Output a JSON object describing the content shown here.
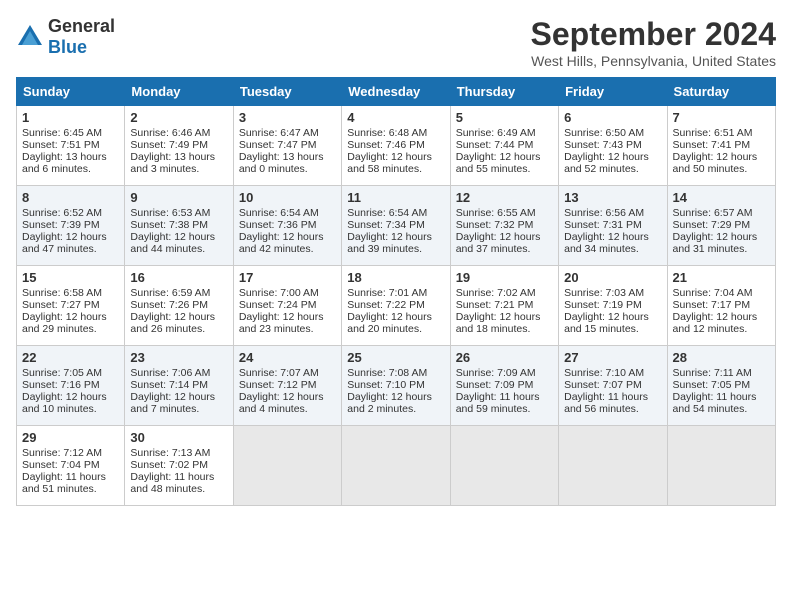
{
  "logo": {
    "general": "General",
    "blue": "Blue"
  },
  "title": "September 2024",
  "location": "West Hills, Pennsylvania, United States",
  "days_of_week": [
    "Sunday",
    "Monday",
    "Tuesday",
    "Wednesday",
    "Thursday",
    "Friday",
    "Saturday"
  ],
  "weeks": [
    [
      {
        "day": "1",
        "sunrise": "6:45 AM",
        "sunset": "7:51 PM",
        "daylight": "13 hours and 6 minutes."
      },
      {
        "day": "2",
        "sunrise": "6:46 AM",
        "sunset": "7:49 PM",
        "daylight": "13 hours and 3 minutes."
      },
      {
        "day": "3",
        "sunrise": "6:47 AM",
        "sunset": "7:47 PM",
        "daylight": "13 hours and 0 minutes."
      },
      {
        "day": "4",
        "sunrise": "6:48 AM",
        "sunset": "7:46 PM",
        "daylight": "12 hours and 58 minutes."
      },
      {
        "day": "5",
        "sunrise": "6:49 AM",
        "sunset": "7:44 PM",
        "daylight": "12 hours and 55 minutes."
      },
      {
        "day": "6",
        "sunrise": "6:50 AM",
        "sunset": "7:43 PM",
        "daylight": "12 hours and 52 minutes."
      },
      {
        "day": "7",
        "sunrise": "6:51 AM",
        "sunset": "7:41 PM",
        "daylight": "12 hours and 50 minutes."
      }
    ],
    [
      {
        "day": "8",
        "sunrise": "6:52 AM",
        "sunset": "7:39 PM",
        "daylight": "12 hours and 47 minutes."
      },
      {
        "day": "9",
        "sunrise": "6:53 AM",
        "sunset": "7:38 PM",
        "daylight": "12 hours and 44 minutes."
      },
      {
        "day": "10",
        "sunrise": "6:54 AM",
        "sunset": "7:36 PM",
        "daylight": "12 hours and 42 minutes."
      },
      {
        "day": "11",
        "sunrise": "6:54 AM",
        "sunset": "7:34 PM",
        "daylight": "12 hours and 39 minutes."
      },
      {
        "day": "12",
        "sunrise": "6:55 AM",
        "sunset": "7:32 PM",
        "daylight": "12 hours and 37 minutes."
      },
      {
        "day": "13",
        "sunrise": "6:56 AM",
        "sunset": "7:31 PM",
        "daylight": "12 hours and 34 minutes."
      },
      {
        "day": "14",
        "sunrise": "6:57 AM",
        "sunset": "7:29 PM",
        "daylight": "12 hours and 31 minutes."
      }
    ],
    [
      {
        "day": "15",
        "sunrise": "6:58 AM",
        "sunset": "7:27 PM",
        "daylight": "12 hours and 29 minutes."
      },
      {
        "day": "16",
        "sunrise": "6:59 AM",
        "sunset": "7:26 PM",
        "daylight": "12 hours and 26 minutes."
      },
      {
        "day": "17",
        "sunrise": "7:00 AM",
        "sunset": "7:24 PM",
        "daylight": "12 hours and 23 minutes."
      },
      {
        "day": "18",
        "sunrise": "7:01 AM",
        "sunset": "7:22 PM",
        "daylight": "12 hours and 20 minutes."
      },
      {
        "day": "19",
        "sunrise": "7:02 AM",
        "sunset": "7:21 PM",
        "daylight": "12 hours and 18 minutes."
      },
      {
        "day": "20",
        "sunrise": "7:03 AM",
        "sunset": "7:19 PM",
        "daylight": "12 hours and 15 minutes."
      },
      {
        "day": "21",
        "sunrise": "7:04 AM",
        "sunset": "7:17 PM",
        "daylight": "12 hours and 12 minutes."
      }
    ],
    [
      {
        "day": "22",
        "sunrise": "7:05 AM",
        "sunset": "7:16 PM",
        "daylight": "12 hours and 10 minutes."
      },
      {
        "day": "23",
        "sunrise": "7:06 AM",
        "sunset": "7:14 PM",
        "daylight": "12 hours and 7 minutes."
      },
      {
        "day": "24",
        "sunrise": "7:07 AM",
        "sunset": "7:12 PM",
        "daylight": "12 hours and 4 minutes."
      },
      {
        "day": "25",
        "sunrise": "7:08 AM",
        "sunset": "7:10 PM",
        "daylight": "12 hours and 2 minutes."
      },
      {
        "day": "26",
        "sunrise": "7:09 AM",
        "sunset": "7:09 PM",
        "daylight": "11 hours and 59 minutes."
      },
      {
        "day": "27",
        "sunrise": "7:10 AM",
        "sunset": "7:07 PM",
        "daylight": "11 hours and 56 minutes."
      },
      {
        "day": "28",
        "sunrise": "7:11 AM",
        "sunset": "7:05 PM",
        "daylight": "11 hours and 54 minutes."
      }
    ],
    [
      {
        "day": "29",
        "sunrise": "7:12 AM",
        "sunset": "7:04 PM",
        "daylight": "11 hours and 51 minutes."
      },
      {
        "day": "30",
        "sunrise": "7:13 AM",
        "sunset": "7:02 PM",
        "daylight": "11 hours and 48 minutes."
      },
      null,
      null,
      null,
      null,
      null
    ]
  ]
}
